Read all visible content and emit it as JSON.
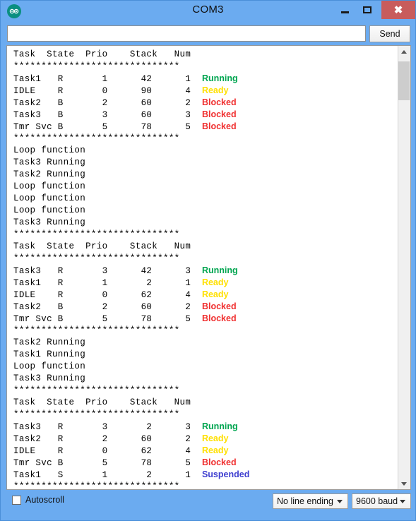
{
  "window": {
    "title": "COM3",
    "logo_icon": "arduino-logo-icon",
    "minimize_label": "",
    "maximize_label": "",
    "close_label": "✖"
  },
  "send_row": {
    "input_value": "",
    "input_placeholder": "",
    "send_label": "Send"
  },
  "bottom_bar": {
    "autoscroll_label": "Autoscroll",
    "autoscroll_checked": false,
    "line_ending_value": "No line ending",
    "baud_value": "9600 baud"
  },
  "scrollbar": {
    "up_icon": "chevron-up-icon",
    "down_icon": "chevron-down-icon"
  },
  "colors": {
    "running": "#00a550",
    "ready": "#ffe000",
    "blocked": "#f03030",
    "suspended": "#4040d0",
    "text": "#000000",
    "titlebar": "#6babf0",
    "close_button": "#c85c5c"
  },
  "console": {
    "separator": "******************************",
    "table_header": "Task  State  Prio    Stack   Num",
    "lines": [
      {
        "text": "Task  State  Prio    Stack   Num",
        "status": "",
        "color": ""
      },
      {
        "text": "******************************",
        "status": "",
        "color": ""
      },
      {
        "text": "Task1   R       1      42      1  ",
        "status": "Running",
        "color": "#00a550"
      },
      {
        "text": "IDLE    R       0      90      4  ",
        "status": "Ready",
        "color": "#ffe000"
      },
      {
        "text": "Task2   B       2      60      2  ",
        "status": "Blocked",
        "color": "#f03030"
      },
      {
        "text": "Task3   B       3      60      3  ",
        "status": "Blocked",
        "color": "#f03030"
      },
      {
        "text": "Tmr Svc B       5      78      5  ",
        "status": "Blocked",
        "color": "#f03030"
      },
      {
        "text": "******************************",
        "status": "",
        "color": ""
      },
      {
        "text": "Loop function",
        "status": "",
        "color": ""
      },
      {
        "text": "Task3 Running",
        "status": "",
        "color": ""
      },
      {
        "text": "Task2 Running",
        "status": "",
        "color": ""
      },
      {
        "text": "Loop function",
        "status": "",
        "color": ""
      },
      {
        "text": "Loop function",
        "status": "",
        "color": ""
      },
      {
        "text": "Loop function",
        "status": "",
        "color": ""
      },
      {
        "text": "Task3 Running",
        "status": "",
        "color": ""
      },
      {
        "text": "******************************",
        "status": "",
        "color": ""
      },
      {
        "text": "Task  State  Prio    Stack   Num",
        "status": "",
        "color": ""
      },
      {
        "text": "******************************",
        "status": "",
        "color": ""
      },
      {
        "text": "Task3   R       3      42      3  ",
        "status": "Running",
        "color": "#00a550"
      },
      {
        "text": "Task1   R       1       2      1  ",
        "status": "Ready",
        "color": "#ffe000"
      },
      {
        "text": "IDLE    R       0      62      4  ",
        "status": "Ready",
        "color": "#ffe000"
      },
      {
        "text": "Task2   B       2      60      2  ",
        "status": "Blocked",
        "color": "#f03030"
      },
      {
        "text": "Tmr Svc B       5      78      5  ",
        "status": "Blocked",
        "color": "#f03030"
      },
      {
        "text": "******************************",
        "status": "",
        "color": ""
      },
      {
        "text": "Task2 Running",
        "status": "",
        "color": ""
      },
      {
        "text": "Task1 Running",
        "status": "",
        "color": ""
      },
      {
        "text": "Loop function",
        "status": "",
        "color": ""
      },
      {
        "text": "Task3 Running",
        "status": "",
        "color": ""
      },
      {
        "text": "******************************",
        "status": "",
        "color": ""
      },
      {
        "text": "Task  State  Prio    Stack   Num",
        "status": "",
        "color": ""
      },
      {
        "text": "******************************",
        "status": "",
        "color": ""
      },
      {
        "text": "Task3   R       3       2      3  ",
        "status": "Running",
        "color": "#00a550"
      },
      {
        "text": "Task2   R       2      60      2  ",
        "status": "Ready",
        "color": "#ffe000"
      },
      {
        "text": "IDLE    R       0      62      4  ",
        "status": "Ready",
        "color": "#ffe000"
      },
      {
        "text": "Tmr Svc B       5      78      5  ",
        "status": "Blocked",
        "color": "#f03030"
      },
      {
        "text": "Task1   S       1       2      1  ",
        "status": "Suspended",
        "color": "#4040d0"
      },
      {
        "text": "******************************",
        "status": "",
        "color": ""
      }
    ]
  }
}
